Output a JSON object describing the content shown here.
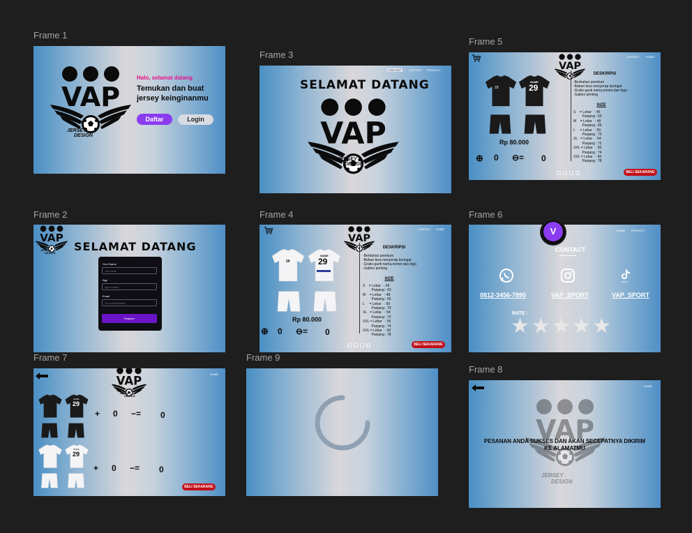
{
  "frames": {
    "f1": {
      "label": "Frame 1",
      "greeting": "Halo, selamat datang",
      "headline": "Temukan dan buat jersey keinginanmu",
      "daftar": "Daftar",
      "login": "Login"
    },
    "f2": {
      "label": "Frame 2",
      "title": "SELAMAT DATANG",
      "name_label": "Your Name",
      "name_placeholder": "Your name",
      "age_label": "Age",
      "age_placeholder": "Age in years",
      "email_label": "Email",
      "email_placeholder": "Your email address",
      "register": "Register"
    },
    "f3": {
      "label": "Frame 3",
      "title": "SELAMAT DATANG",
      "nav": [
        "LOG OUT",
        "CONTACT",
        "PRODUCT"
      ]
    },
    "f4": {
      "label": "Frame 4",
      "nav": [
        "CONTACT",
        "HOME"
      ],
      "price": "Rp 80.000",
      "qty1": "0",
      "qty2": "0",
      "beli": "BELI SEKARANG"
    },
    "f5": {
      "label": "Frame 5",
      "nav": [
        "CONTACT",
        "HOME"
      ],
      "price": "Rp 80.000",
      "qty1": "0",
      "qty2": "0",
      "beli": "BELI SEKARANG"
    },
    "f6": {
      "label": "Frame 6",
      "nav": [
        "HOME",
        "PRODUCT"
      ],
      "avatar": "V",
      "title": "CONTACT",
      "phone": "0812-3456-7890",
      "instagram": "VAP_SPORT",
      "tiktok": "VAP_SPORT",
      "tiktok_caption": "TikTok",
      "rate": "RATE :",
      "rating": 0,
      "rating_max": 5
    },
    "f7": {
      "label": "Frame 7",
      "nav": "HOME",
      "row1_qty1": "0",
      "row1_qty2": "0",
      "row2_qty1": "0",
      "row2_qty2": "0",
      "beli": "BELI SEKARANG"
    },
    "f8": {
      "label": "Frame 8",
      "nav": "HOME",
      "message": "PESANAN ANDA SUKSES DAN AKAN SECEPATNYA DIKIRIM KE ALAMATMU"
    },
    "f9": {
      "label": "Frame 9"
    }
  },
  "brand": {
    "logo_text": "VAP",
    "tagline_1": "JERSEY",
    "tagline_2": "DESIGN"
  },
  "description": {
    "title": "DESKRIPSI",
    "items": [
      "-Berbahan premium",
      "-Bahan bisa menyerap keringat",
      "-Gratis ganti nama,nomer,dan logo",
      "-Sablon printing"
    ]
  },
  "size": {
    "title": "SIZE",
    "rows": [
      "S    = Lebar   : 45",
      "         Panjang : 63",
      "M    = Lebar   : 48",
      "         Panjang : 65",
      "L     = Lebar   : 50",
      "         Panjang : 70",
      "XL   = Lebar   : 54",
      "         Panjang : 72",
      "XXL = Lebar   : 56",
      "         Panjang : 74",
      "XXL = Lebar   : 60",
      "         Panjang : 78"
    ]
  },
  "jersey": {
    "name": "NAME",
    "number": "29"
  },
  "pager": [
    "<",
    "1",
    "2",
    ">"
  ],
  "colors": {
    "canvas": "#1e1e1e",
    "accent_purple": "#8a3cf0",
    "accent_pink": "#e8108a",
    "beli_red": "#c20f18",
    "register_purple": "#6a14c8"
  }
}
